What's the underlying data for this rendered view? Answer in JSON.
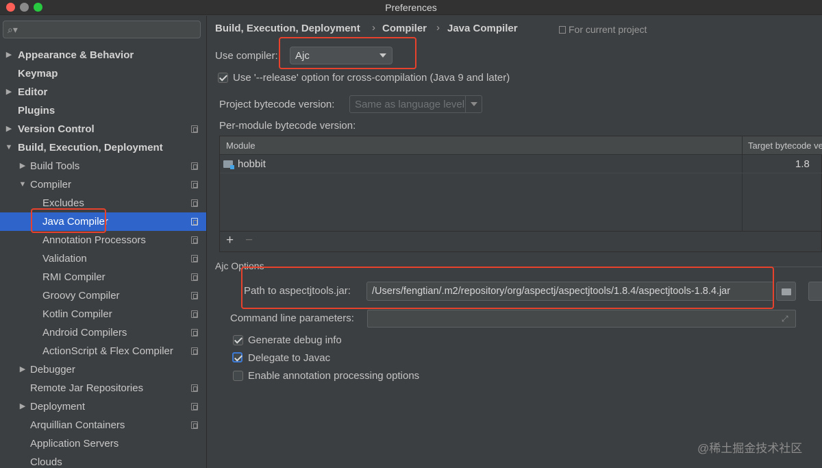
{
  "window": {
    "title": "Preferences"
  },
  "sidebar": {
    "search_placeholder": "",
    "items": [
      {
        "label": "Appearance & Behavior"
      },
      {
        "label": "Keymap"
      },
      {
        "label": "Editor"
      },
      {
        "label": "Plugins"
      },
      {
        "label": "Version Control"
      },
      {
        "label": "Build, Execution, Deployment"
      },
      {
        "label": "Build Tools"
      },
      {
        "label": "Compiler"
      },
      {
        "label": "Excludes"
      },
      {
        "label": "Java Compiler"
      },
      {
        "label": "Annotation Processors"
      },
      {
        "label": "Validation"
      },
      {
        "label": "RMI Compiler"
      },
      {
        "label": "Groovy Compiler"
      },
      {
        "label": "Kotlin Compiler"
      },
      {
        "label": "Android Compilers"
      },
      {
        "label": "ActionScript & Flex Compiler"
      },
      {
        "label": "Debugger"
      },
      {
        "label": "Remote Jar Repositories"
      },
      {
        "label": "Deployment"
      },
      {
        "label": "Arquillian Containers"
      },
      {
        "label": "Application Servers"
      },
      {
        "label": "Clouds"
      }
    ]
  },
  "breadcrumb": {
    "parts": [
      "Build, Execution, Deployment",
      "Compiler",
      "Java Compiler"
    ],
    "separator": "›",
    "scope": "For current project"
  },
  "compiler": {
    "use_compiler_label": "Use compiler:",
    "use_compiler_value": "Ajc",
    "release_option_label": "Use '--release' option for cross-compilation (Java 9 and later)",
    "release_option_checked": true,
    "bytecode_label": "Project bytecode version:",
    "bytecode_value": "Same as language level",
    "per_module_label": "Per-module bytecode version:"
  },
  "module_table": {
    "columns": [
      "Module",
      "Target bytecode version"
    ],
    "rows": [
      {
        "module": "hobbit",
        "target": "1.8"
      }
    ],
    "add_label": "+",
    "remove_label": "−"
  },
  "ajc": {
    "section_label": "Ajc Options",
    "path_label": "Path to aspectjtools.jar:",
    "path_value": "/Users/fengtian/.m2/repository/org/aspectj/aspectjtools/1.8.4/aspectjtools-1.8.4.jar",
    "cmd_label": "Command line parameters:",
    "cmd_value": "",
    "options": [
      {
        "label": "Generate debug info",
        "checked": true
      },
      {
        "label": "Delegate to Javac",
        "checked": true
      },
      {
        "label": "Enable annotation processing options",
        "checked": false
      }
    ]
  },
  "watermark": "@稀土掘金技术社区",
  "icons": {
    "search": "search-icon",
    "expand_arrow": "▶",
    "collapse_arrow": "▼",
    "add": "plus-icon",
    "remove": "minus-icon",
    "folder": "folder-icon",
    "expand_field": "⤢"
  },
  "colors": {
    "selection": "#2f65ca",
    "highlight_box": "#e8412c",
    "background": "#3c3f41"
  }
}
